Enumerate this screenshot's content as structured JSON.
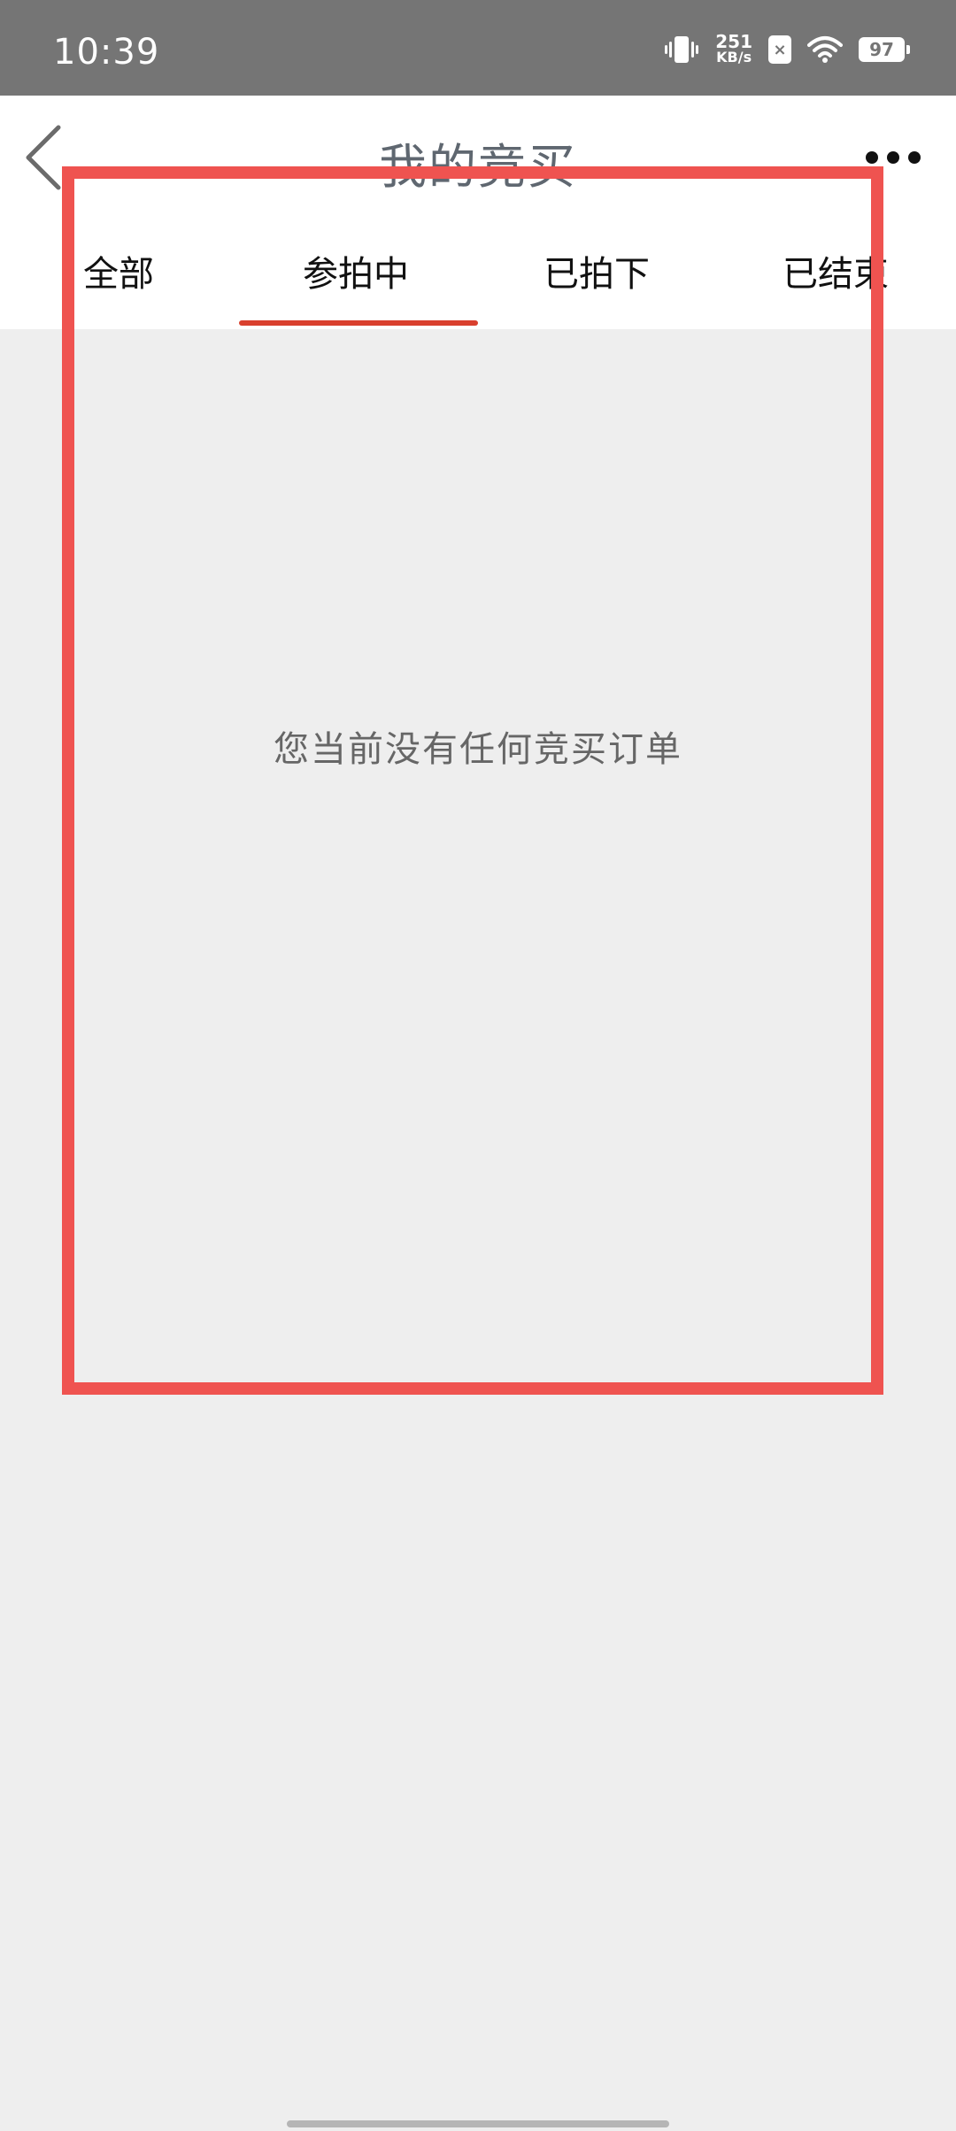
{
  "status_bar": {
    "time": "10:39",
    "net_speed_value": "251",
    "net_speed_unit": "KB/s",
    "sim_label": "×",
    "battery": "97"
  },
  "header": {
    "title": "我的竞买"
  },
  "tabs": [
    {
      "label": "全部",
      "selected": false
    },
    {
      "label": "参拍中",
      "selected": true
    },
    {
      "label": "已拍下",
      "selected": false
    },
    {
      "label": "已结束",
      "selected": false
    }
  ],
  "content": {
    "empty_message": "您当前没有任何竞买订单"
  },
  "colors": {
    "status_bar_bg": "#757575",
    "accent": "#d9402e",
    "highlight": "#ef5350",
    "content_bg": "#eeeeee"
  }
}
